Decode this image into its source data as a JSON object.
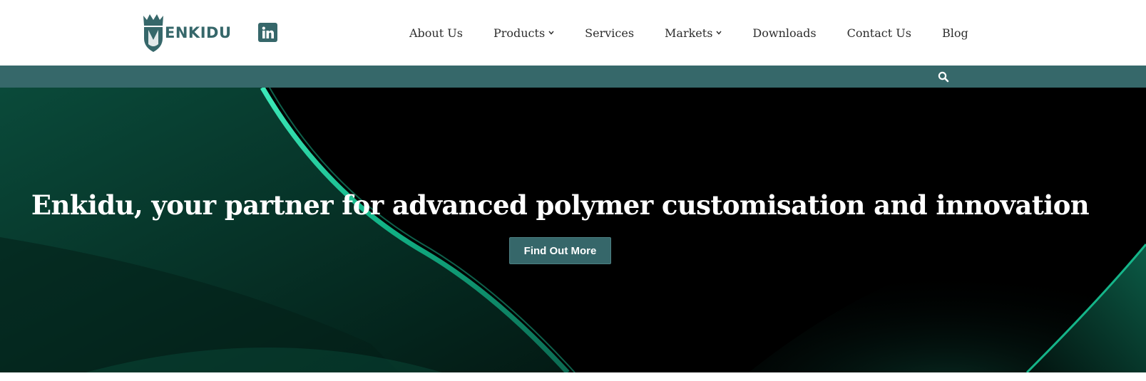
{
  "brand": {
    "name": "ENKIDU",
    "color": "#36676a"
  },
  "social": {
    "linkedin_label": "in",
    "icon": "linkedin-icon"
  },
  "nav": {
    "items": [
      {
        "label": "About Us",
        "has_dropdown": false
      },
      {
        "label": "Products",
        "has_dropdown": true
      },
      {
        "label": "Services",
        "has_dropdown": false
      },
      {
        "label": "Markets",
        "has_dropdown": true
      },
      {
        "label": "Downloads",
        "has_dropdown": false
      },
      {
        "label": "Contact Us",
        "has_dropdown": false
      },
      {
        "label": "Blog",
        "has_dropdown": false
      }
    ]
  },
  "subbar": {
    "color": "#36686a",
    "search_icon": "search-icon"
  },
  "hero": {
    "title": "Enkidu, your partner for advanced polymer customisation and innovation",
    "button_label": "Find Out More",
    "accent": "#19c99a"
  }
}
